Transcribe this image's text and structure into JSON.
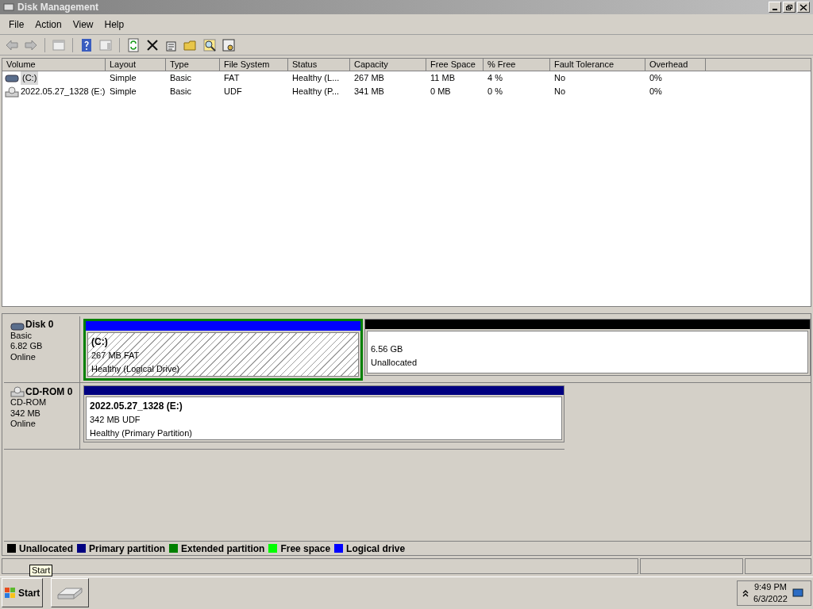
{
  "window": {
    "title": "Disk Management"
  },
  "menu": [
    "File",
    "Action",
    "View",
    "Help"
  ],
  "table": {
    "columns": [
      "Volume",
      "Layout",
      "Type",
      "File System",
      "Status",
      "Capacity",
      "Free Space",
      "% Free",
      "Fault Tolerance",
      "Overhead"
    ],
    "rows": [
      {
        "kind": "disk",
        "selected": true,
        "cells": [
          "(C:)",
          "Simple",
          "Basic",
          "FAT",
          "Healthy (L...",
          "267 MB",
          "11 MB",
          "4 %",
          "No",
          "0%"
        ]
      },
      {
        "kind": "cdrom",
        "selected": false,
        "cells": [
          "2022.05.27_1328 (E:)",
          "Simple",
          "Basic",
          "UDF",
          "Healthy (P...",
          "341 MB",
          "0 MB",
          "0 %",
          "No",
          "0%"
        ]
      }
    ]
  },
  "disks": [
    {
      "kind": "disk",
      "name": "Disk 0",
      "info": [
        "Basic",
        "6.82 GB",
        "Online"
      ],
      "partitions": [
        {
          "kind": "logical",
          "selected": true,
          "title": "(C:)",
          "lines": [
            "267 MB FAT",
            "Healthy (Logical Drive)"
          ]
        },
        {
          "kind": "unallocated",
          "selected": false,
          "lines": [
            "6.56 GB",
            "Unallocated"
          ]
        }
      ]
    },
    {
      "kind": "cdrom",
      "name": "CD-ROM 0",
      "info": [
        "CD-ROM",
        "342 MB",
        "Online"
      ],
      "partitions": [
        {
          "kind": "primary",
          "selected": false,
          "title": "2022.05.27_1328  (E:)",
          "lines": [
            "342 MB UDF",
            "Healthy (Primary Partition)"
          ]
        }
      ]
    }
  ],
  "legend": [
    {
      "label": "Unallocated",
      "color": "#000000"
    },
    {
      "label": "Primary partition",
      "color": "#000080"
    },
    {
      "label": "Extended partition",
      "color": "#008000"
    },
    {
      "label": "Free space",
      "color": "#00ff00"
    },
    {
      "label": "Logical drive",
      "color": "#0000ff"
    }
  ],
  "taskbar": {
    "start": "Start",
    "tooltip": "Start",
    "time": "9:49 PM",
    "date": "6/3/2022"
  }
}
